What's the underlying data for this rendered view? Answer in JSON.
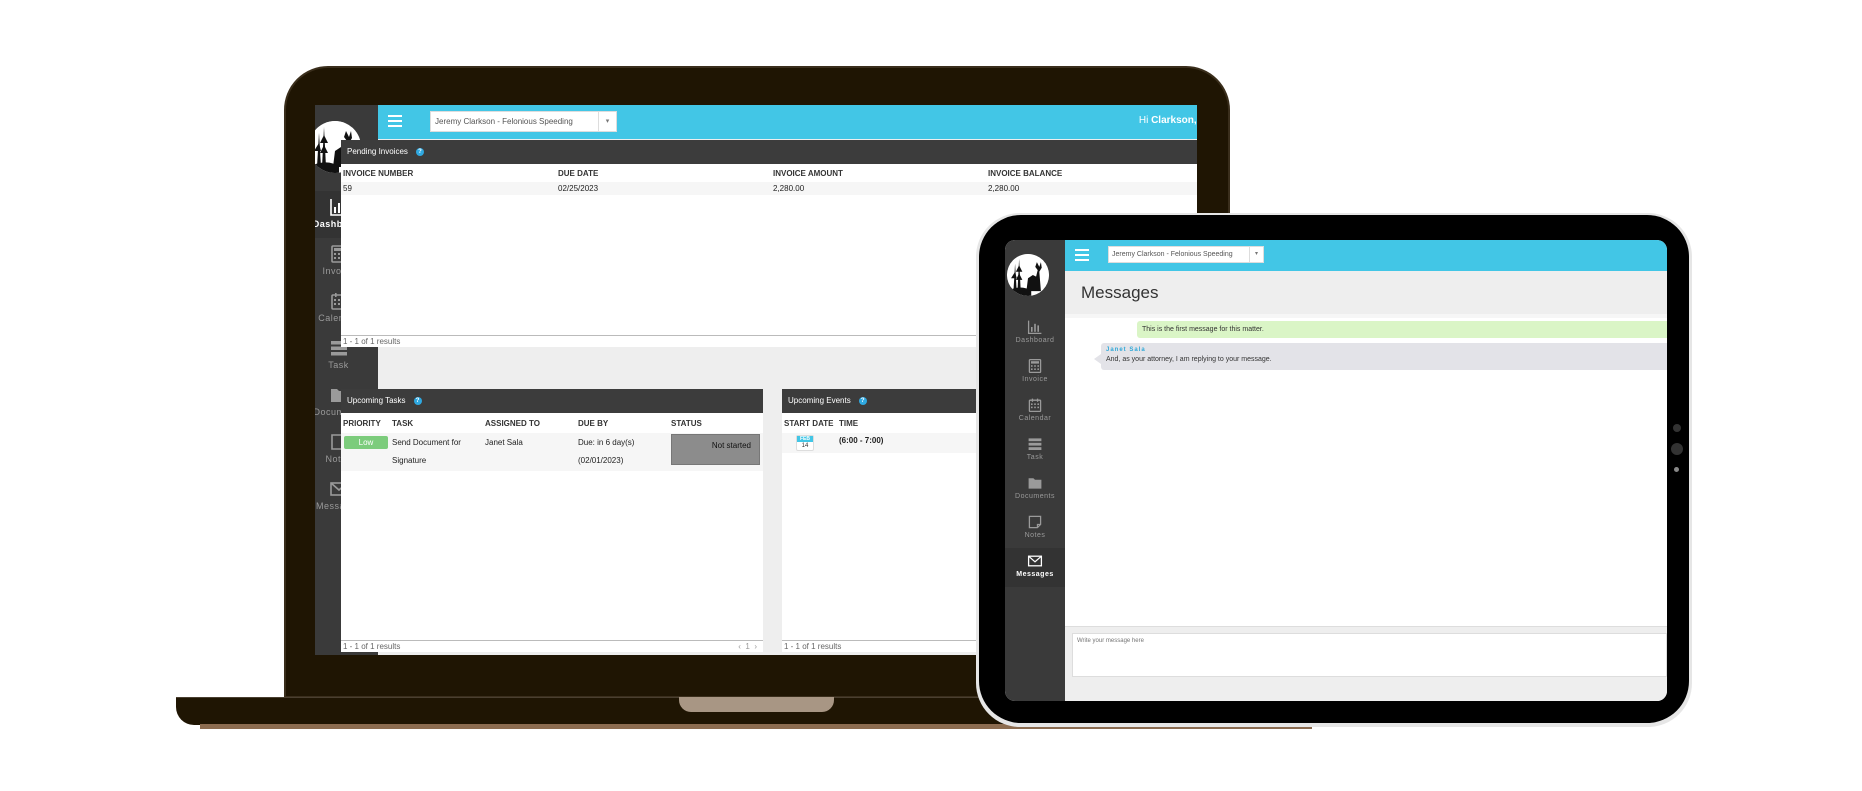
{
  "laptop": {
    "topbar": {
      "matter_select": "Jeremy Clarkson - Felonious Speeding",
      "greeting_prefix": "Hi ",
      "greeting_name": "Clarkson, J"
    },
    "sidebar": {
      "items": [
        {
          "label": "Dashboard",
          "icon": "bar-chart-icon",
          "active": true
        },
        {
          "label": "Invoice",
          "icon": "calculator-icon",
          "active": false
        },
        {
          "label": "Calendar",
          "icon": "calendar-icon",
          "active": false
        },
        {
          "label": "Task",
          "icon": "tasks-icon",
          "active": false
        },
        {
          "label": "Documents",
          "icon": "folder-icon",
          "active": false
        },
        {
          "label": "Notes",
          "icon": "note-icon",
          "active": false
        },
        {
          "label": "Messages",
          "icon": "envelope-icon",
          "active": false
        }
      ]
    },
    "pending_invoices": {
      "title": "Pending Invoices",
      "help": "?",
      "columns": [
        "INVOICE NUMBER",
        "DUE DATE",
        "INVOICE AMOUNT",
        "INVOICE BALANCE"
      ],
      "rows": [
        {
          "number": "59",
          "due_date": "02/25/2023",
          "amount": "2,280.00",
          "balance": "2,280.00"
        }
      ],
      "footer": "1 - 1 of 1 results"
    },
    "upcoming_tasks": {
      "title": "Upcoming Tasks",
      "help": "?",
      "columns": [
        "PRIORITY",
        "TASK",
        "ASSIGNED TO",
        "DUE BY",
        "STATUS"
      ],
      "rows": [
        {
          "priority": "Low",
          "task_line1": "Send Document for",
          "task_line2": "Signature",
          "assigned_to": "Janet Sala",
          "due_line1": "Due: in 6 day(s)",
          "due_line2": "(02/01/2023)",
          "status": "Not started"
        }
      ],
      "footer": "1 - 1 of 1 results",
      "pager_prev": "‹",
      "pager_page": "1",
      "pager_next": "›"
    },
    "upcoming_events": {
      "title": "Upcoming Events",
      "help": "?",
      "columns": [
        "START DATE",
        "TIME"
      ],
      "rows": [
        {
          "month": "FEB",
          "day": "14",
          "time": "(6:00 - 7:00)"
        }
      ],
      "footer": "1 - 1 of 1 results"
    }
  },
  "tablet": {
    "topbar": {
      "matter_select": "Jeremy Clarkson - Felonious Speeding"
    },
    "page_title": "Messages",
    "sidebar": {
      "items": [
        {
          "label": "Dashboard",
          "icon": "bar-chart-icon",
          "active": false
        },
        {
          "label": "Invoice",
          "icon": "calculator-icon",
          "active": false
        },
        {
          "label": "Calendar",
          "icon": "calendar-icon",
          "active": false
        },
        {
          "label": "Task",
          "icon": "tasks-icon",
          "active": false
        },
        {
          "label": "Documents",
          "icon": "folder-icon",
          "active": false
        },
        {
          "label": "Notes",
          "icon": "note-icon",
          "active": false
        },
        {
          "label": "Messages",
          "icon": "envelope-icon",
          "active": true
        }
      ]
    },
    "messages": [
      {
        "type": "sent",
        "text": "This is the first message for this matter."
      },
      {
        "type": "received",
        "sender": "Janet Sala",
        "text": "And, as your attorney, I am replying to your message."
      }
    ],
    "compose": {
      "placeholder": "Write your message here",
      "value": ""
    }
  },
  "colors": {
    "accent": "#42c6e6",
    "sidebar": "#3a3a3a",
    "panel_header": "#3c3c3c",
    "priority_low": "#7ccc7c",
    "sent_bubble": "#daf5c6",
    "received_bubble": "#e3e3e8",
    "laptop_body": "#1f1503"
  }
}
